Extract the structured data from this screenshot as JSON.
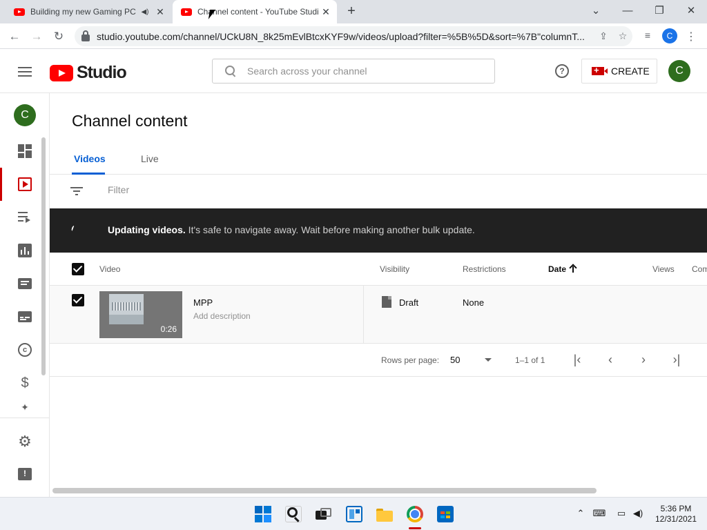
{
  "browser": {
    "tabs": [
      {
        "title": "Building my new Gaming PC",
        "active": false
      },
      {
        "title": "Channel content - YouTube Studio",
        "active": true
      }
    ],
    "url": "studio.youtube.com/channel/UCkU8N_8k25mEvlBtcxKYF9w/videos/upload?filter=%5B%5D&sort=%7B\"columnT...",
    "profile_initial": "C"
  },
  "header": {
    "logo_text": "Studio",
    "search_placeholder": "Search across your channel",
    "create_label": "CREATE",
    "avatar_initial": "C"
  },
  "rail": {
    "channel_initial": "C",
    "items": [
      "dashboard",
      "content",
      "playlists",
      "analytics",
      "comments",
      "subtitles",
      "copyright",
      "earn",
      "customization",
      "settings",
      "feedback"
    ],
    "active": "content"
  },
  "main": {
    "title": "Channel content",
    "tabs": [
      {
        "label": "Videos",
        "active": true
      },
      {
        "label": "Live",
        "active": false
      }
    ],
    "filter_placeholder": "Filter",
    "banner": {
      "bold": "Updating videos.",
      "rest": " It's safe to navigate away. Wait before making another bulk update."
    },
    "columns": {
      "video": "Video",
      "visibility": "Visibility",
      "restrictions": "Restrictions",
      "date": "Date",
      "views": "Views",
      "comments": "Com"
    },
    "rows": [
      {
        "title": "MPP",
        "description": "Add description",
        "duration": "0:26",
        "visibility": "Draft",
        "restrictions": "None",
        "checked": true
      }
    ],
    "pagination": {
      "rows_per_page_label": "Rows per page:",
      "rows_per_page": "50",
      "range": "1–1 of 1"
    }
  },
  "taskbar": {
    "time": "5:36 PM",
    "date": "12/31/2021"
  },
  "colors": {
    "accent_blue": "#065fd4",
    "brand_red": "#ff0000",
    "banner_bg": "#212121",
    "avatar_green": "#2e6d1e"
  }
}
